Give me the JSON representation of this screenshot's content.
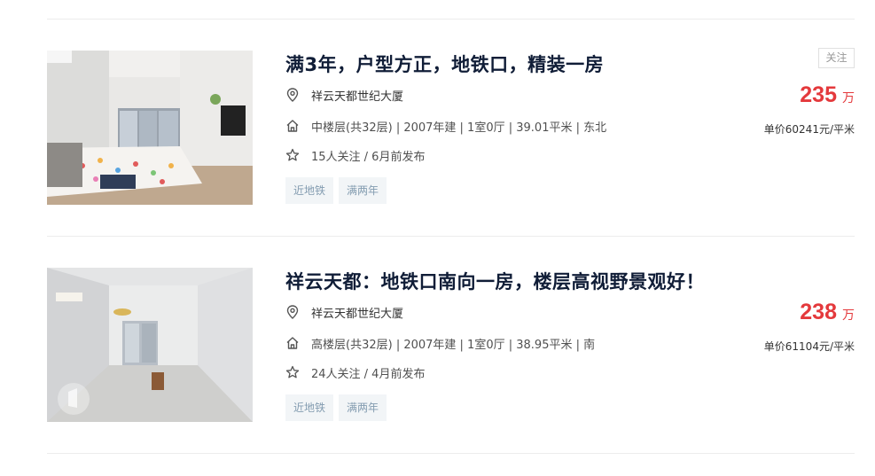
{
  "listings": [
    {
      "title": "满3年，户型方正，地铁口，精装一房",
      "community": "祥云天都世纪大厦",
      "info": "中楼层(共32层) | 2007年建 | 1室0厅 | 39.01平米 | 东北",
      "follow": "15人关注 / 6月前发布",
      "tags": [
        "近地铁",
        "满两年"
      ],
      "price": "235",
      "price_unit": "万",
      "unit_price": "单价60241元/平米",
      "follow_button": "关注"
    },
    {
      "title": "祥云天都：地铁口南向一房，楼层高视野景观好！",
      "community": "祥云天都世纪大厦",
      "info": "高楼层(共32层) | 2007年建 | 1室0厅 | 38.95平米 | 南",
      "follow": "24人关注 / 4月前发布",
      "tags": [
        "近地铁",
        "满两年"
      ],
      "price": "238",
      "price_unit": "万",
      "unit_price": "单价61104元/平米"
    }
  ],
  "colors": {
    "title": "#101d37",
    "price": "#e4393c",
    "tag_bg": "#f2f5f7",
    "tag_text": "#839cb0"
  },
  "icons": [
    "location-pin-icon",
    "house-icon",
    "star-icon"
  ]
}
